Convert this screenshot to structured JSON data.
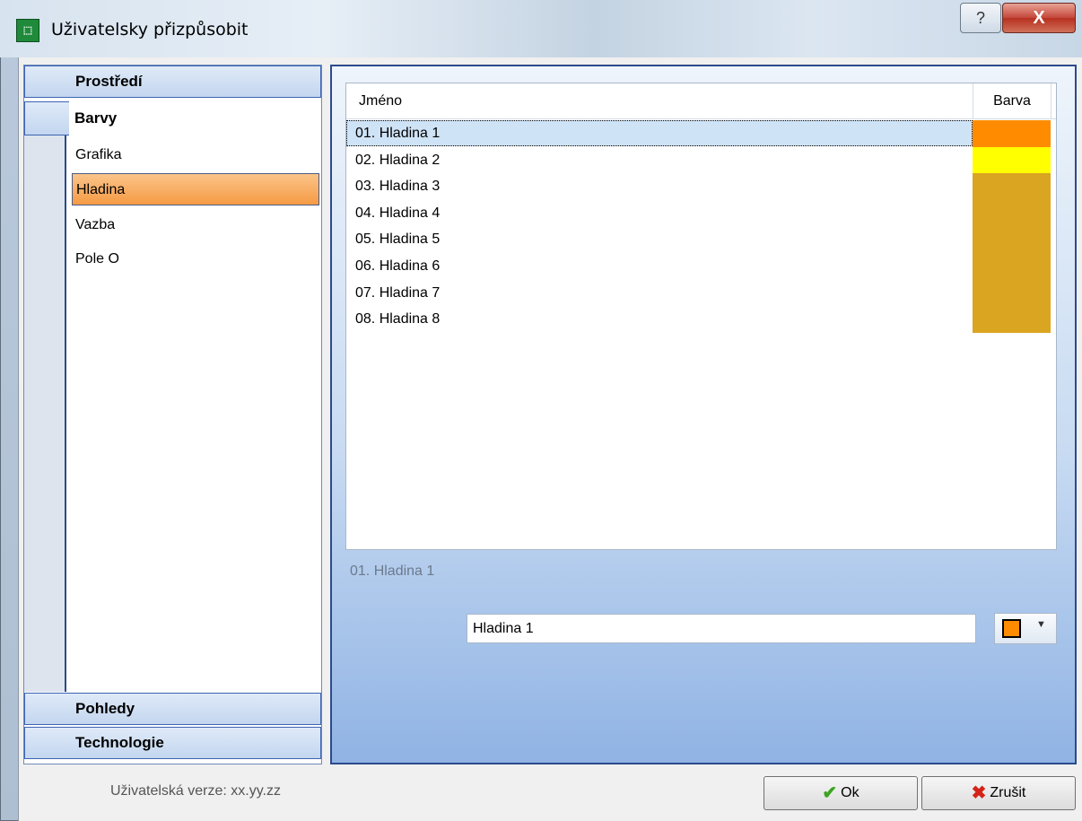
{
  "window": {
    "title": "Uživatelsky přizpůsobit",
    "app_icon": "app-icon",
    "help_label": "?",
    "close_label": "X"
  },
  "nav": {
    "sections": [
      {
        "label": "Prostředí"
      },
      {
        "label": "Barvy"
      },
      {
        "label": "Pohledy"
      },
      {
        "label": "Technologie"
      }
    ],
    "barvy_items": [
      {
        "label": "Grafika"
      },
      {
        "label": "Hladina",
        "selected": true
      },
      {
        "label": "Vazba"
      },
      {
        "label": "Pole O"
      }
    ]
  },
  "list": {
    "columns": {
      "name": "Jméno",
      "color": "Barva"
    },
    "rows": [
      {
        "label": "01. Hladina 1",
        "color": "#ff8c00"
      },
      {
        "label": "02. Hladina 2",
        "color": "#ffff00"
      },
      {
        "label": "03. Hladina 3",
        "color": "#daa520"
      },
      {
        "label": "04. Hladina 4",
        "color": "#daa520"
      },
      {
        "label": "05. Hladina 5",
        "color": "#daa520"
      },
      {
        "label": "06. Hladina 6",
        "color": "#daa520"
      },
      {
        "label": "07. Hladina 7",
        "color": "#daa520"
      },
      {
        "label": "08. Hladina 8",
        "color": "#daa520"
      }
    ],
    "selected_index": 0
  },
  "detail": {
    "caption": "01. Hladina 1",
    "name_value": "Hladina 1",
    "picker_color": "#ff8c00"
  },
  "footer": {
    "version": "Uživatelská verze: xx.yy.zz",
    "ok_label": "Ok",
    "cancel_label": "Zrušit"
  }
}
